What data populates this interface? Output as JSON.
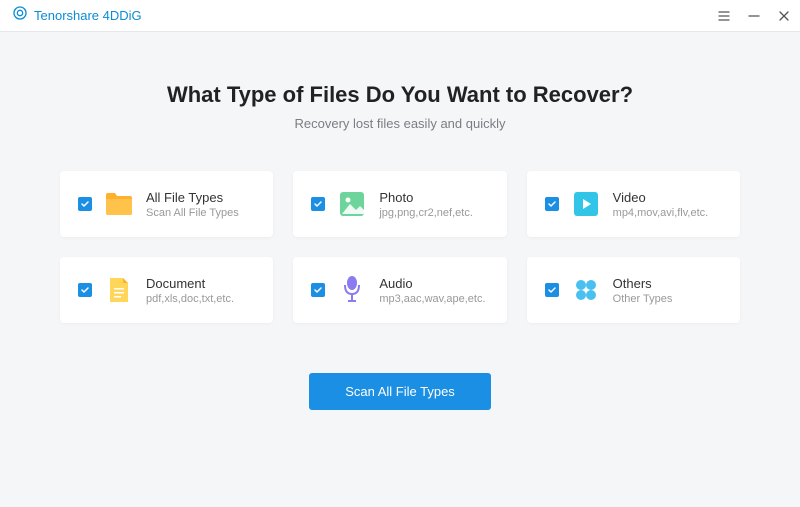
{
  "app": {
    "name": "Tenorshare 4DDiG"
  },
  "main": {
    "title": "What Type of Files Do You Want to Recover?",
    "subtitle": "Recovery lost files easily and quickly"
  },
  "fileTypes": [
    {
      "title": "All File Types",
      "sub": "Scan All File Types"
    },
    {
      "title": "Photo",
      "sub": "jpg,png,cr2,nef,etc."
    },
    {
      "title": "Video",
      "sub": "mp4,mov,avi,flv,etc."
    },
    {
      "title": "Document",
      "sub": "pdf,xls,doc,txt,etc."
    },
    {
      "title": "Audio",
      "sub": "mp3,aac,wav,ape,etc."
    },
    {
      "title": "Others",
      "sub": "Other Types"
    }
  ],
  "scanButton": {
    "label": "Scan All File Types"
  }
}
